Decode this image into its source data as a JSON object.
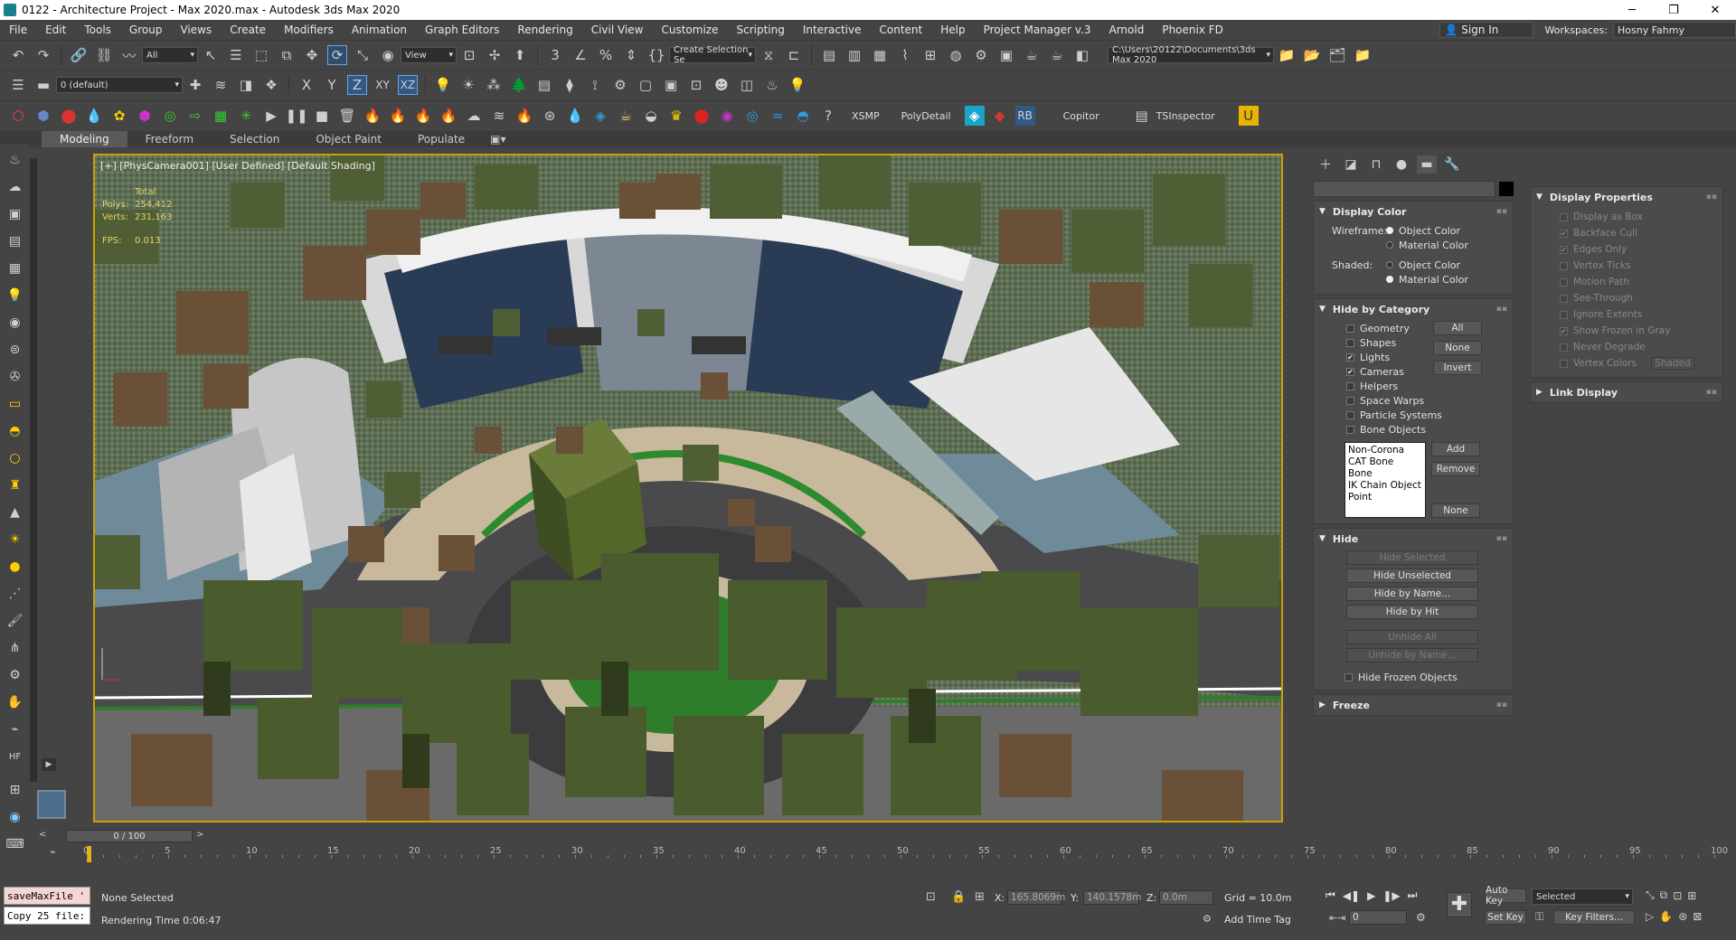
{
  "titlebar": {
    "title": "0122 - Architecture Project - Max 2020.max - Autodesk 3ds Max 2020",
    "min": "─",
    "max": "❐",
    "close": "✕"
  },
  "menu": {
    "items": [
      "File",
      "Edit",
      "Tools",
      "Group",
      "Views",
      "Create",
      "Modifiers",
      "Animation",
      "Graph Editors",
      "Rendering",
      "Civil View",
      "Customize",
      "Scripting",
      "Interactive",
      "Content",
      "Help",
      "Project Manager v.3",
      "Arnold",
      "Phoenix FD"
    ],
    "signin": "Sign In",
    "workspaces_label": "Workspaces:",
    "workspace_value": "Hosny Fahmy"
  },
  "toolbar1": {
    "filter_value": "All",
    "refcoord_value": "View",
    "selection_set_placeholder": "Create Selection Se",
    "project_path": "C:\\Users\\20122\\Documents\\3ds Max 2020"
  },
  "toolbar2": {
    "layer_value": "0 (default)",
    "x": "X",
    "y": "Y",
    "z": "Z",
    "xy": "XY",
    "xz": "XZ"
  },
  "toolbar3": {
    "xsmp": "XSMP",
    "polydetail": "PolyDetail",
    "rb": "RB",
    "copitor": "Copitor",
    "tsinspector": "TSInspector"
  },
  "ribbon": {
    "tabs": [
      "Modeling",
      "Freeform",
      "Selection",
      "Object Paint",
      "Populate"
    ]
  },
  "viewport": {
    "label": "[+] [PhysCamera001] [User Defined] [Default Shading]",
    "stats": {
      "total_label": "Total",
      "polys_label": "Polys:",
      "polys": "254,412",
      "verts_label": "Verts:",
      "verts": "231,163",
      "fps_label": "FPS:",
      "fps": "0.013"
    }
  },
  "cmdpanel": {
    "display_color": {
      "title": "Display Color",
      "wireframe_label": "Wireframe:",
      "shaded_label": "Shaded:",
      "object_color": "Object Color",
      "material_color": "Material Color"
    },
    "hide_by_category": {
      "title": "Hide by Category",
      "categories": [
        "Geometry",
        "Shapes",
        "Lights",
        "Cameras",
        "Helpers",
        "Space Warps",
        "Particle Systems",
        "Bone Objects"
      ],
      "checked": [
        false,
        false,
        true,
        true,
        false,
        false,
        false,
        false
      ],
      "btn_all": "All",
      "btn_none": "None",
      "btn_invert": "Invert",
      "list": [
        "Non-Corona",
        "CAT Bone",
        "Bone",
        "IK Chain Object",
        "Point"
      ],
      "btn_add": "Add",
      "btn_remove": "Remove",
      "btn_none2": "None"
    },
    "hide": {
      "title": "Hide",
      "buttons": [
        "Hide Selected",
        "Hide Unselected",
        "Hide by Name...",
        "Hide by Hit",
        "Unhide All",
        "Unhide by Name..."
      ],
      "hide_frozen": "Hide Frozen Objects"
    },
    "freeze": {
      "title": "Freeze"
    }
  },
  "display_props": {
    "title": "Display Properties",
    "items": [
      "Display as Box",
      "Backface Cull",
      "Edges Only",
      "Vertex Ticks",
      "Motion Path",
      "See-Through",
      "Ignore Extents",
      "Show Frozen in Gray",
      "Never Degrade",
      "Vertex Colors"
    ],
    "checked": [
      false,
      true,
      true,
      false,
      false,
      false,
      false,
      true,
      false,
      false
    ],
    "shaded_btn": "Shaded",
    "link_display": "Link Display"
  },
  "timeline": {
    "slider": "0 / 100",
    "ticks": [
      "0",
      "5",
      "10",
      "15",
      "20",
      "25",
      "30",
      "35",
      "40",
      "45",
      "50",
      "55",
      "60",
      "65",
      "70",
      "75",
      "80",
      "85",
      "90",
      "95",
      "100"
    ]
  },
  "status": {
    "script1": "saveMaxFile '",
    "script2": "Copy 25 file:",
    "none_selected": "None Selected",
    "rendering_time": "Rendering Time  0:06:47",
    "x_label": "X:",
    "x": "165.8069m",
    "y_label": "Y:",
    "y": "140.1578m",
    "z_label": "Z:",
    "z": "0.0m",
    "grid": "Grid = 10.0m",
    "add_time_tag": "Add Time Tag",
    "auto_key": "Auto Key",
    "set_key": "Set Key",
    "selected": "Selected",
    "frame": "0",
    "key_filters": "Key Filters..."
  }
}
